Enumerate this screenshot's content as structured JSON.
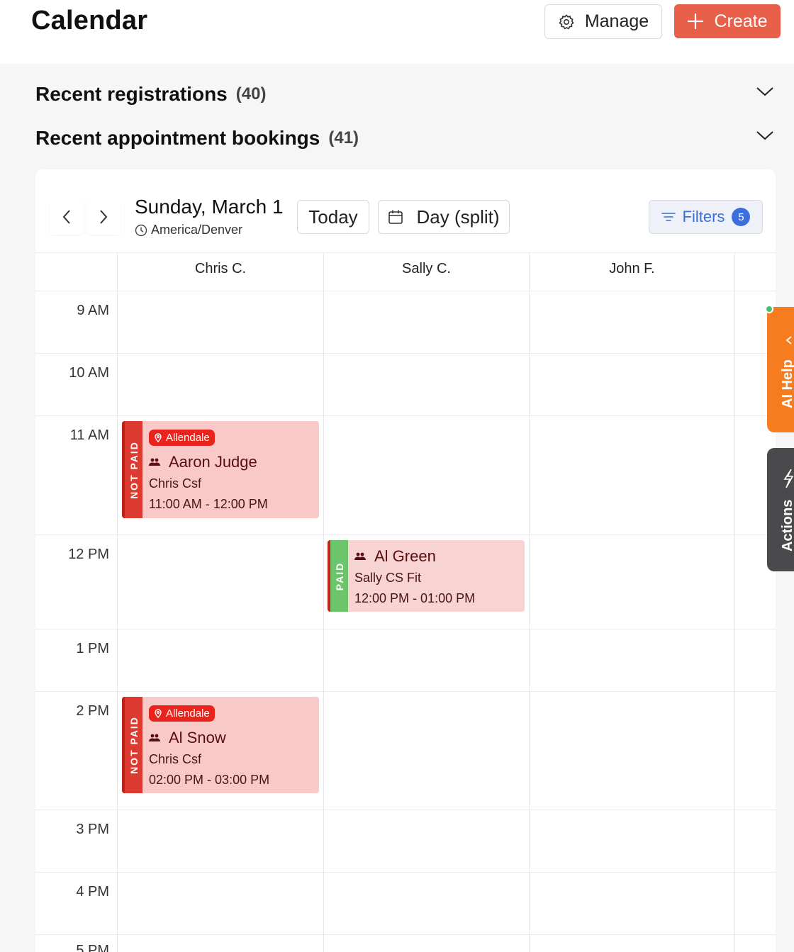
{
  "header": {
    "title": "Calendar",
    "manage_label": "Manage",
    "create_label": "Create",
    "accent_color": "#e8604a"
  },
  "sections": {
    "registrations": {
      "label": "Recent registrations",
      "count": "(40)"
    },
    "appointments": {
      "label": "Recent appointment bookings",
      "count": "(41)"
    }
  },
  "toolbar": {
    "date": "Sunday, March 1",
    "timezone": "America/Denver",
    "today_label": "Today",
    "view_label": "Day (split)",
    "filters_label": "Filters",
    "filters_count": "5"
  },
  "calendar": {
    "columns": [
      "Chris C.",
      "Sally C.",
      "John F."
    ],
    "hours": [
      "9 AM",
      "10 AM",
      "11 AM",
      "12 PM",
      "1 PM",
      "2 PM",
      "3 PM",
      "4 PM",
      "5 PM"
    ],
    "events": [
      {
        "status": "NOT PAID",
        "location": "Allendale",
        "name": "Aaron Judge",
        "service": "Chris Csf",
        "time": "11:00 AM - 12:00 PM"
      },
      {
        "status": "PAID",
        "name": "Al Green",
        "service": "Sally CS Fit",
        "time": "12:00 PM - 01:00 PM"
      },
      {
        "status": "NOT PAID",
        "location": "Allendale",
        "name": "Al Snow",
        "service": "Chris Csf",
        "time": "02:00 PM - 03:00 PM"
      }
    ]
  },
  "side_tabs": {
    "ai_help": "AI Help",
    "actions": "Actions"
  },
  "colors": {
    "not_paid": "#dd3b31",
    "paid": "#6cc46b",
    "ai_help_tab": "#f57c1f",
    "actions_tab": "#4a4a4c"
  }
}
